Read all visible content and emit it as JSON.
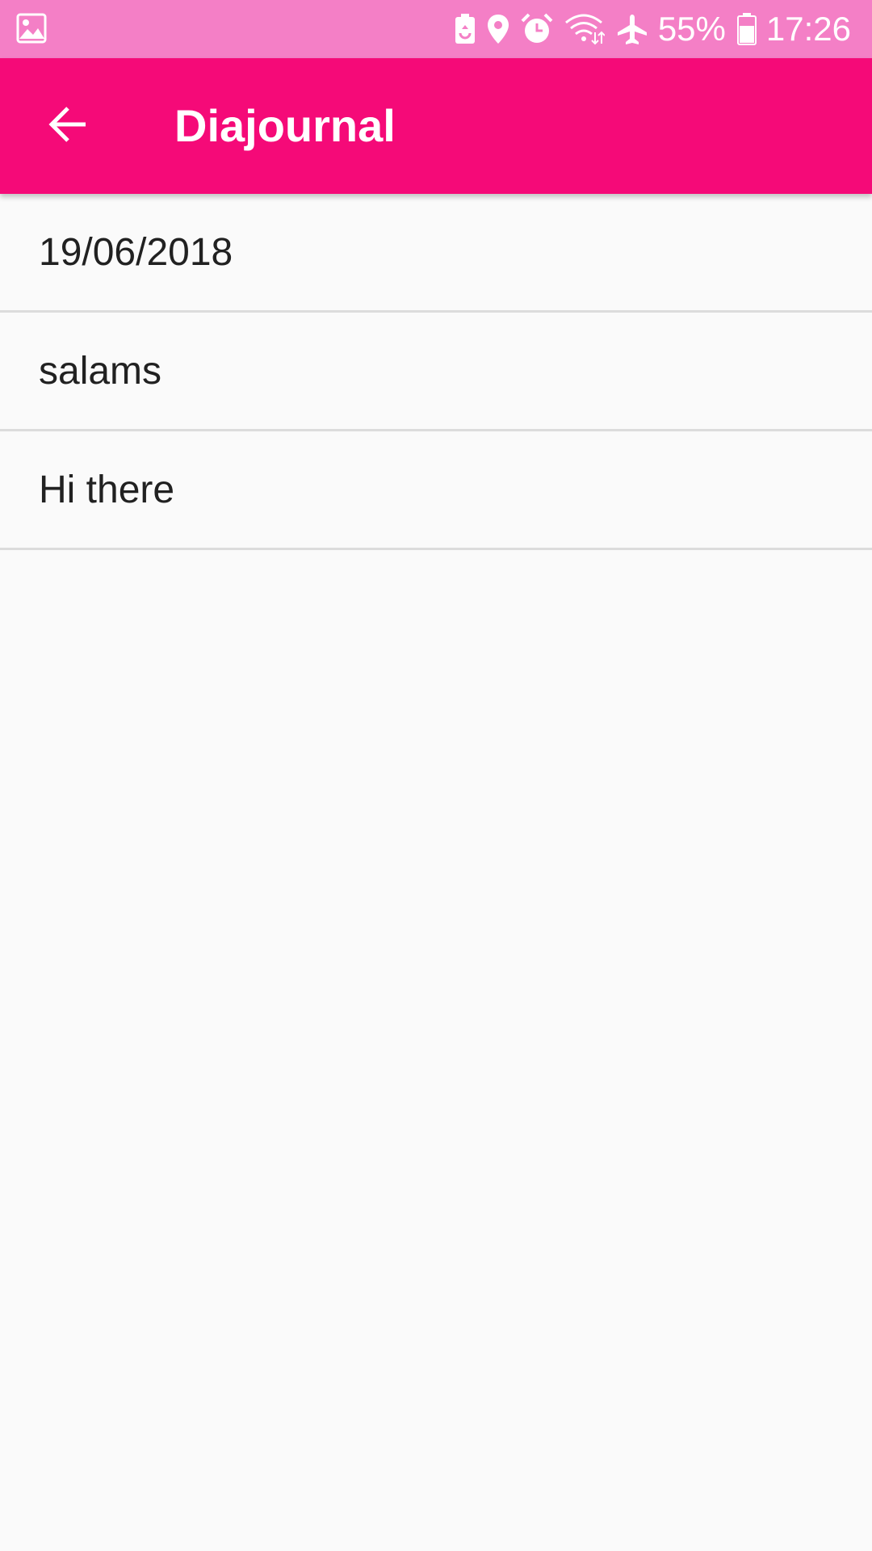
{
  "status_bar": {
    "battery_percent": "55%",
    "time": "17:26",
    "icons": [
      "gallery-icon",
      "battery-saver-icon",
      "location-icon",
      "alarm-icon",
      "wifi-icon",
      "airplane-icon",
      "battery-icon"
    ]
  },
  "app_bar": {
    "title": "Diajournal",
    "back_icon": "arrow-back-icon"
  },
  "entries": [
    {
      "text": "19/06/2018"
    },
    {
      "text": "salams"
    },
    {
      "text": "Hi there"
    }
  ],
  "colors": {
    "status_bar": "#F47FC6",
    "app_bar": "#F50A78",
    "background": "#FAFAFA",
    "divider": "#DCDCDC",
    "text": "#212121"
  }
}
